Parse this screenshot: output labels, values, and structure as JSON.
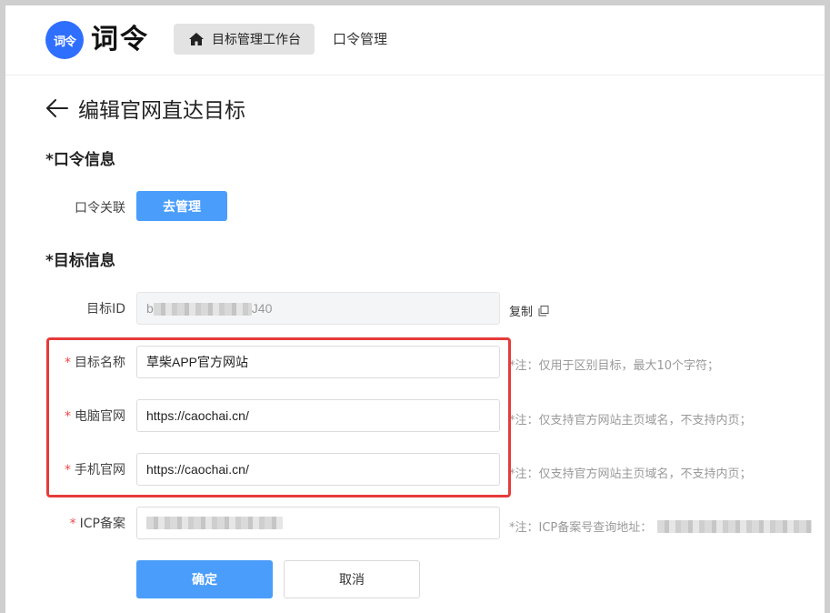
{
  "header": {
    "logo_badge": "词令",
    "logo_text": "词令",
    "nav_home": "目标管理工作台",
    "nav_password": "口令管理"
  },
  "page": {
    "title": "编辑官网直达目标"
  },
  "password_section": {
    "title": "*口令信息",
    "link_label": "口令关联",
    "manage_button": "去管理"
  },
  "target_section": {
    "title": "*目标信息",
    "id_label": "目标ID",
    "id_prefix": "b",
    "id_suffix": "J40",
    "copy_label": "复制",
    "name_label": "目标名称",
    "name_value": "草柴APP官方网站",
    "name_note": "*注：仅用于区别目标，最大10个字符；",
    "pc_label": "电脑官网",
    "pc_value": "https://caochai.cn/",
    "pc_note": "*注：仅支持官方网站主页域名，不支持内页；",
    "mobile_label": "手机官网",
    "mobile_value": "https://caochai.cn/",
    "mobile_note": "*注：仅支持官方网站主页域名，不支持内页；",
    "icp_label": "ICP备案",
    "icp_note": "*注：ICP备案号查询地址："
  },
  "actions": {
    "confirm": "确定",
    "cancel": "取消"
  },
  "colors": {
    "primary": "#4a9dfa",
    "logo": "#2f6fff",
    "highlight": "#e63b3b",
    "required": "#f04848"
  }
}
